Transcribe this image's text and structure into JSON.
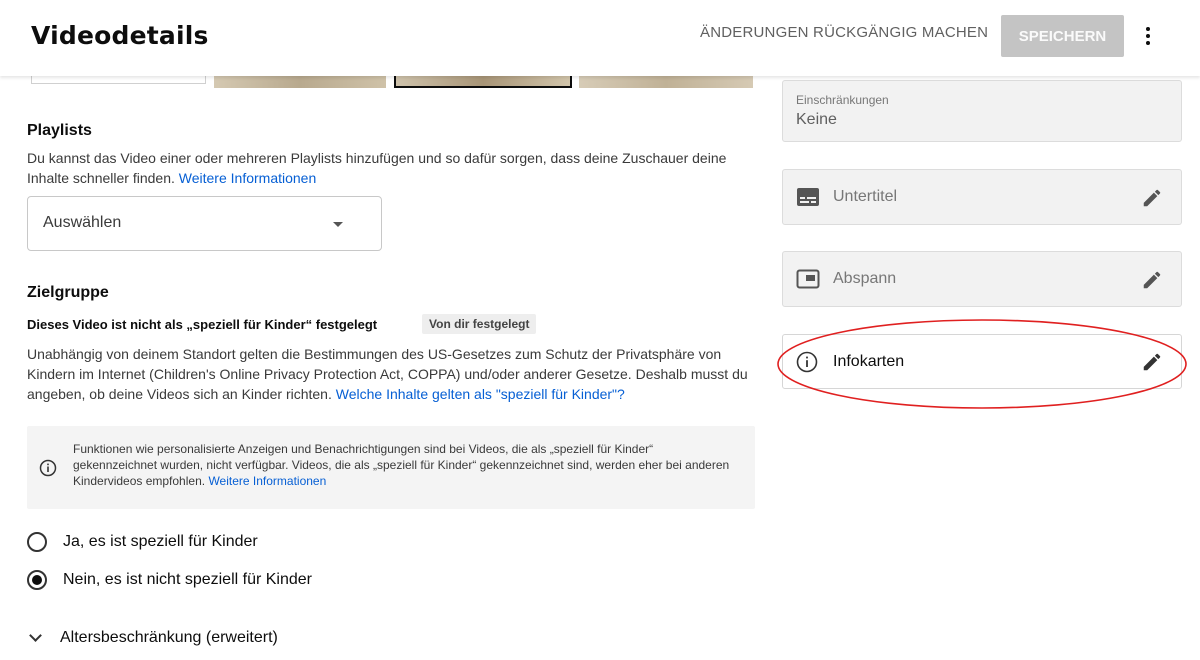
{
  "header": {
    "title": "Videodetails",
    "undo_label": "ÄNDERUNGEN RÜCKGÄNGIG MACHEN",
    "save_label": "SPEICHERN"
  },
  "playlists": {
    "title": "Playlists",
    "description": "Du kannst das Video einer oder mehreren Playlists hinzufügen und so dafür sorgen, dass deine Zuschauer deine Inhalte schneller finden.",
    "link": "Weitere Informationen",
    "select_value": "Auswählen"
  },
  "audience": {
    "title": "Zielgruppe",
    "status_text": "Dieses Video ist nicht als „speziell für Kinder“ festgelegt",
    "badge": "Von dir festgelegt",
    "description": "Unabhängig von deinem Standort gelten die Bestimmungen des US-Gesetzes zum Schutz der Privatsphäre von Kindern im Internet (Children's Online Privacy Protection Act, COPPA) und/oder anderer Gesetze. Deshalb musst du angeben, ob deine Videos sich an Kinder richten.",
    "description_link": "Welche Inhalte gelten als \"speziell für Kinder\"?",
    "info_text": "Funktionen wie personalisierte Anzeigen und Benachrichtigungen sind bei Videos, die als „speziell für Kinder“ gekennzeichnet wurden, nicht verfügbar. Videos, die als „speziell für Kinder“ gekennzeichnet sind, werden eher bei anderen Kindervideos empfohlen.",
    "info_link": "Weitere Informationen",
    "option_yes": "Ja, es ist speziell für Kinder",
    "option_no": "Nein, es ist nicht speziell für Kinder",
    "selected": "no",
    "age_restriction": "Altersbeschränkung (erweitert)"
  },
  "sidebar": {
    "restrictions_label": "Einschränkungen",
    "restrictions_value": "Keine",
    "subtitles_label": "Untertitel",
    "endscreen_label": "Abspann",
    "cards_label": "Infokarten"
  },
  "colors": {
    "link": "#065fd4",
    "annotation": "#e02020",
    "save_disabled": "#c4c4c4"
  }
}
